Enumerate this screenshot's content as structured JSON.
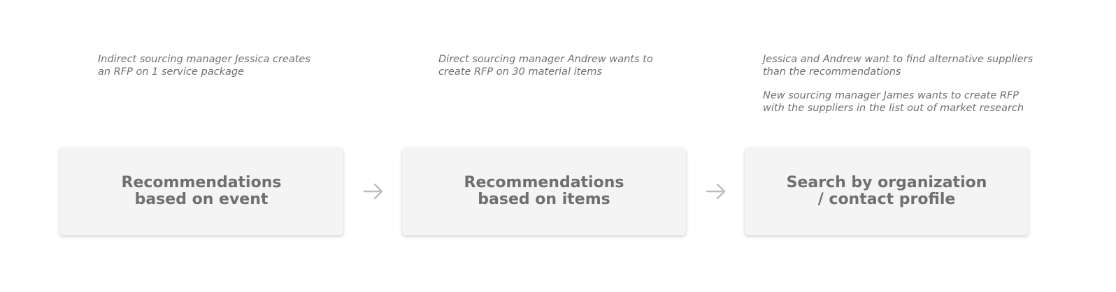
{
  "notes": [
    {
      "paragraphs": [
        "Indirect sourcing manager Jessica creates\nan RFP on 1 service package"
      ]
    },
    {
      "paragraphs": [
        "Direct sourcing manager Andrew wants to\ncreate RFP on 30 material items"
      ]
    },
    {
      "paragraphs": [
        "Jessica and Andrew want to find alternative suppliers\nthan the recommendations",
        "New sourcing manager James wants to create RFP\nwith the suppliers in the list out of market research"
      ]
    }
  ],
  "steps": [
    {
      "label": "Recommendations\nbased on event"
    },
    {
      "label": "Recommendations\nbased on items"
    },
    {
      "label": "Search by organization\n/ contact profile"
    }
  ],
  "colors": {
    "text": "#6f6f6f",
    "card_bg": "#f4f4f4",
    "arrow": "#bdbdbd"
  },
  "icons": [
    "arrow-right-icon",
    "arrow-right-icon"
  ]
}
